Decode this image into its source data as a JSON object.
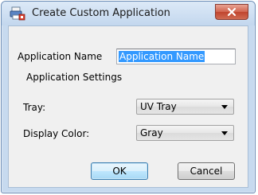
{
  "window": {
    "title": "Create Custom Application",
    "close_glyph": "✕"
  },
  "form": {
    "app_name_label": "Application Name",
    "app_name_value": "Application Name",
    "settings_heading": "Application Settings",
    "tray_label": "Tray:",
    "tray_value": "UV Tray",
    "display_color_label": "Display Color:",
    "display_color_value": "Gray"
  },
  "buttons": {
    "ok": "OK",
    "cancel": "Cancel"
  },
  "icons": {
    "app": "printer-app-icon",
    "close": "close-icon",
    "dropdown": "chevron-down-icon"
  },
  "colors": {
    "selection": "#3399ff",
    "close_button": "#c0442e",
    "default_button_border": "#3c7fb1"
  }
}
